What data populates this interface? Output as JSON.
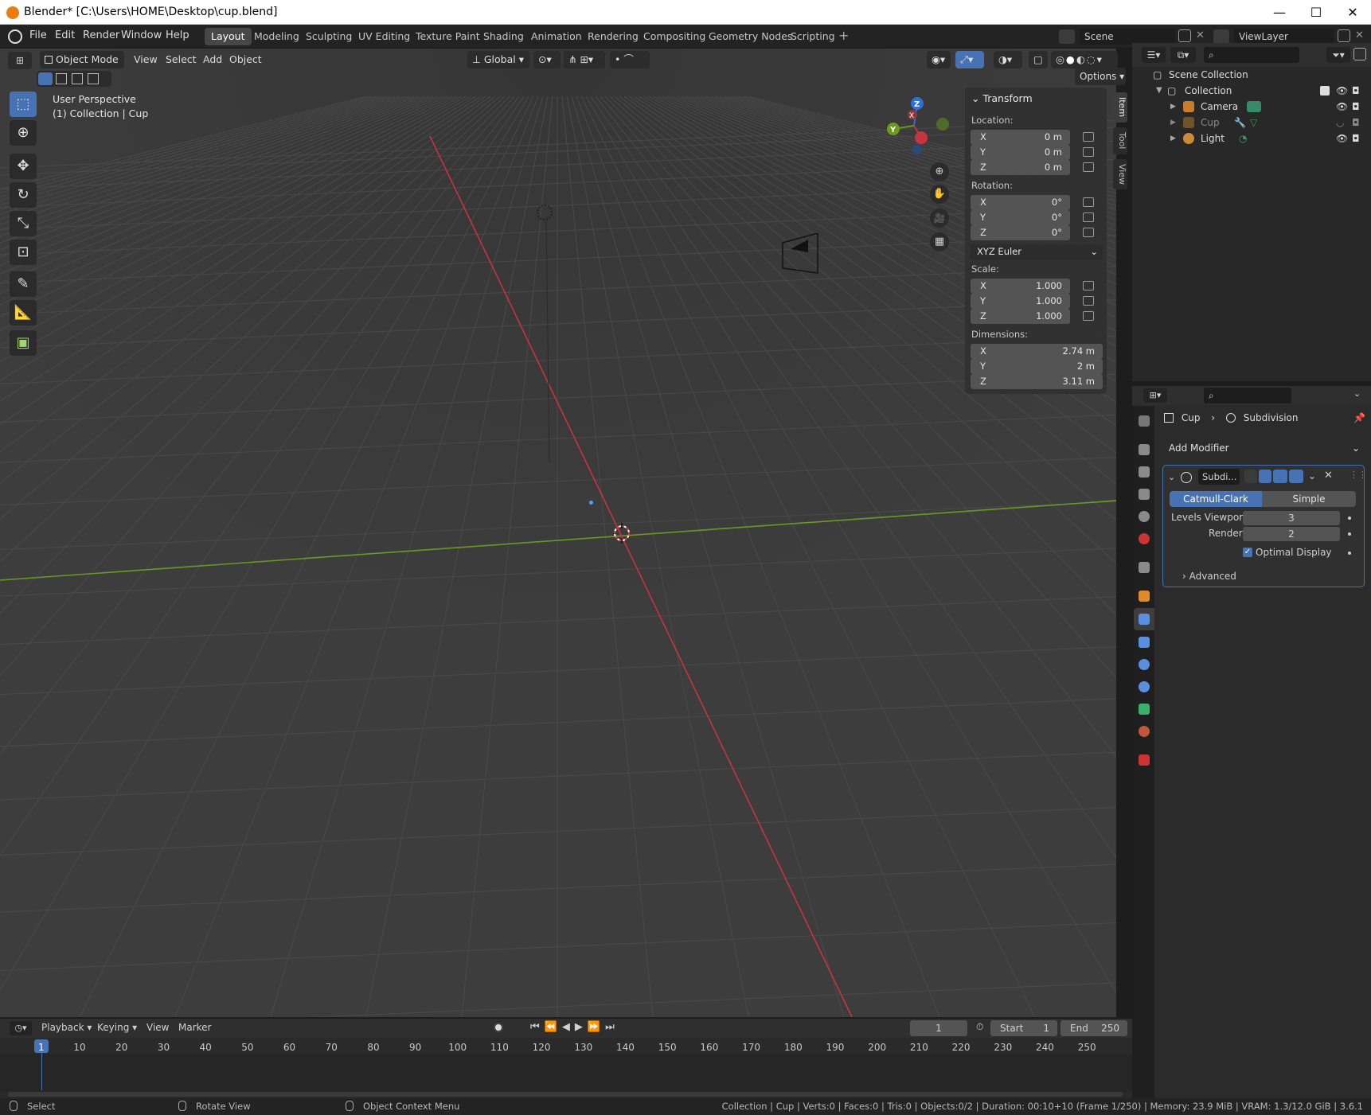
{
  "window": {
    "title": "Blender* [C:\\Users\\HOME\\Desktop\\cup.blend]",
    "minimize": "—",
    "maximize": "☐",
    "close": "✕"
  },
  "menu": [
    "File",
    "Edit",
    "Render",
    "Window",
    "Help"
  ],
  "workspaces": [
    "Layout",
    "Modeling",
    "Sculpting",
    "UV Editing",
    "Texture Paint",
    "Shading",
    "Animation",
    "Rendering",
    "Compositing",
    "Geometry Nodes",
    "Scripting"
  ],
  "active_workspace": "Layout",
  "add_workspace": "+",
  "scene": {
    "name": "Scene",
    "view_layer": "ViewLayer"
  },
  "viewport_header": {
    "mode": "Object Mode",
    "menus": [
      "View",
      "Select",
      "Add",
      "Object"
    ],
    "orientation": "Global",
    "options": "Options"
  },
  "viewport": {
    "perspective": "User Perspective",
    "collection": "(1) Collection | Cup",
    "gizmo": {
      "x": "X",
      "y": "Y",
      "z": "Z"
    }
  },
  "npanel": {
    "header": "Transform",
    "location_label": "Location:",
    "location": [
      {
        "axis": "X",
        "value": "0 m"
      },
      {
        "axis": "Y",
        "value": "0 m"
      },
      {
        "axis": "Z",
        "value": "0 m"
      }
    ],
    "rotation_label": "Rotation:",
    "rotation": [
      {
        "axis": "X",
        "value": "0°"
      },
      {
        "axis": "Y",
        "value": "0°"
      },
      {
        "axis": "Z",
        "value": "0°"
      }
    ],
    "rotation_mode": "XYZ Euler",
    "scale_label": "Scale:",
    "scale": [
      {
        "axis": "X",
        "value": "1.000"
      },
      {
        "axis": "Y",
        "value": "1.000"
      },
      {
        "axis": "Z",
        "value": "1.000"
      }
    ],
    "dimensions_label": "Dimensions:",
    "dimensions": [
      {
        "axis": "X",
        "value": "2.74 m"
      },
      {
        "axis": "Y",
        "value": "2 m"
      },
      {
        "axis": "Z",
        "value": "3.11 m"
      }
    ],
    "tabs": [
      "Item",
      "Tool",
      "View"
    ]
  },
  "outliner": {
    "root": "Scene Collection",
    "collection": "Collection",
    "items": [
      "Camera",
      "Cup",
      "Light"
    ]
  },
  "properties": {
    "breadcrumb_object": "Cup",
    "breadcrumb_modifier": "Subdivision",
    "add_modifier": "Add Modifier",
    "modifier_name": "Subdi...",
    "type_catmull": "Catmull-Clark",
    "type_simple": "Simple",
    "levels_viewport_label": "Levels Viewport",
    "levels_viewport": "3",
    "render_label": "Render",
    "render_value": "2",
    "optimal_display": "Optimal Display",
    "advanced": "Advanced"
  },
  "timeline": {
    "menus": [
      "Playback",
      "Keying",
      "View",
      "Marker"
    ],
    "current_frame": "1",
    "start_label": "Start",
    "start": "1",
    "end_label": "End",
    "end": "250",
    "ticks": [
      "1",
      "10",
      "20",
      "30",
      "40",
      "50",
      "60",
      "70",
      "80",
      "90",
      "100",
      "110",
      "120",
      "130",
      "140",
      "150",
      "160",
      "170",
      "180",
      "190",
      "200",
      "210",
      "220",
      "230",
      "240",
      "250"
    ]
  },
  "statusbar": {
    "select": "Select",
    "rotate": "Rotate View",
    "context": "Object Context Menu",
    "info": "Collection | Cup | Verts:0 | Faces:0 | Tris:0 | Objects:0/2 | Duration: 00:10+10 (Frame 1/250) | Memory: 23.9 MiB | VRAM: 1.3/12.0 GiB | 3.6.1"
  },
  "colors": {
    "accent": "#4772b3",
    "x_axis": "#c5343f",
    "y_axis": "#6a9a1f",
    "z_axis": "#2f6fd6"
  }
}
